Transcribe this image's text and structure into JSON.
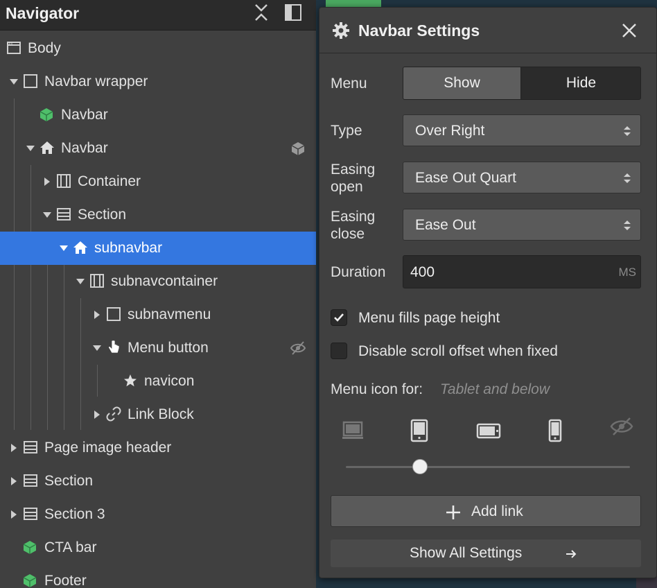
{
  "navigator": {
    "title": "Navigator",
    "tree": [
      {
        "label": "Body"
      },
      {
        "label": "Navbar wrapper"
      },
      {
        "label": "Navbar"
      },
      {
        "label": "Navbar"
      },
      {
        "label": "Container"
      },
      {
        "label": "Section"
      },
      {
        "label": "subnavbar"
      },
      {
        "label": "subnavcontainer"
      },
      {
        "label": "subnavmenu"
      },
      {
        "label": "Menu button"
      },
      {
        "label": "navicon"
      },
      {
        "label": "Link Block"
      },
      {
        "label": "Page image header"
      },
      {
        "label": "Section"
      },
      {
        "label": "Section 3"
      },
      {
        "label": "CTA bar"
      },
      {
        "label": "Footer"
      }
    ]
  },
  "settings": {
    "title": "Navbar Settings",
    "menu": {
      "label": "Menu",
      "options": [
        "Show",
        "Hide"
      ],
      "selected": "Show"
    },
    "type": {
      "label": "Type",
      "value": "Over Right"
    },
    "easing_open": {
      "label_line1": "Easing",
      "label_line2": "open",
      "value": "Ease Out Quart"
    },
    "easing_close": {
      "label_line1": "Easing",
      "label_line2": "close",
      "value": "Ease Out"
    },
    "duration": {
      "label": "Duration",
      "value": "400",
      "unit": "MS"
    },
    "menu_fills_page_height": {
      "label": "Menu fills page height",
      "checked": true
    },
    "disable_scroll_offset": {
      "label": "Disable scroll offset when fixed",
      "checked": false
    },
    "menu_icon_for": {
      "label": "Menu icon for:",
      "value": "Tablet and below"
    },
    "add_link": "Add link",
    "show_all": "Show All Settings"
  },
  "colors": {
    "selection": "#3477e0",
    "component_green": "#4fbf6a",
    "panel_bg": "#404040"
  }
}
